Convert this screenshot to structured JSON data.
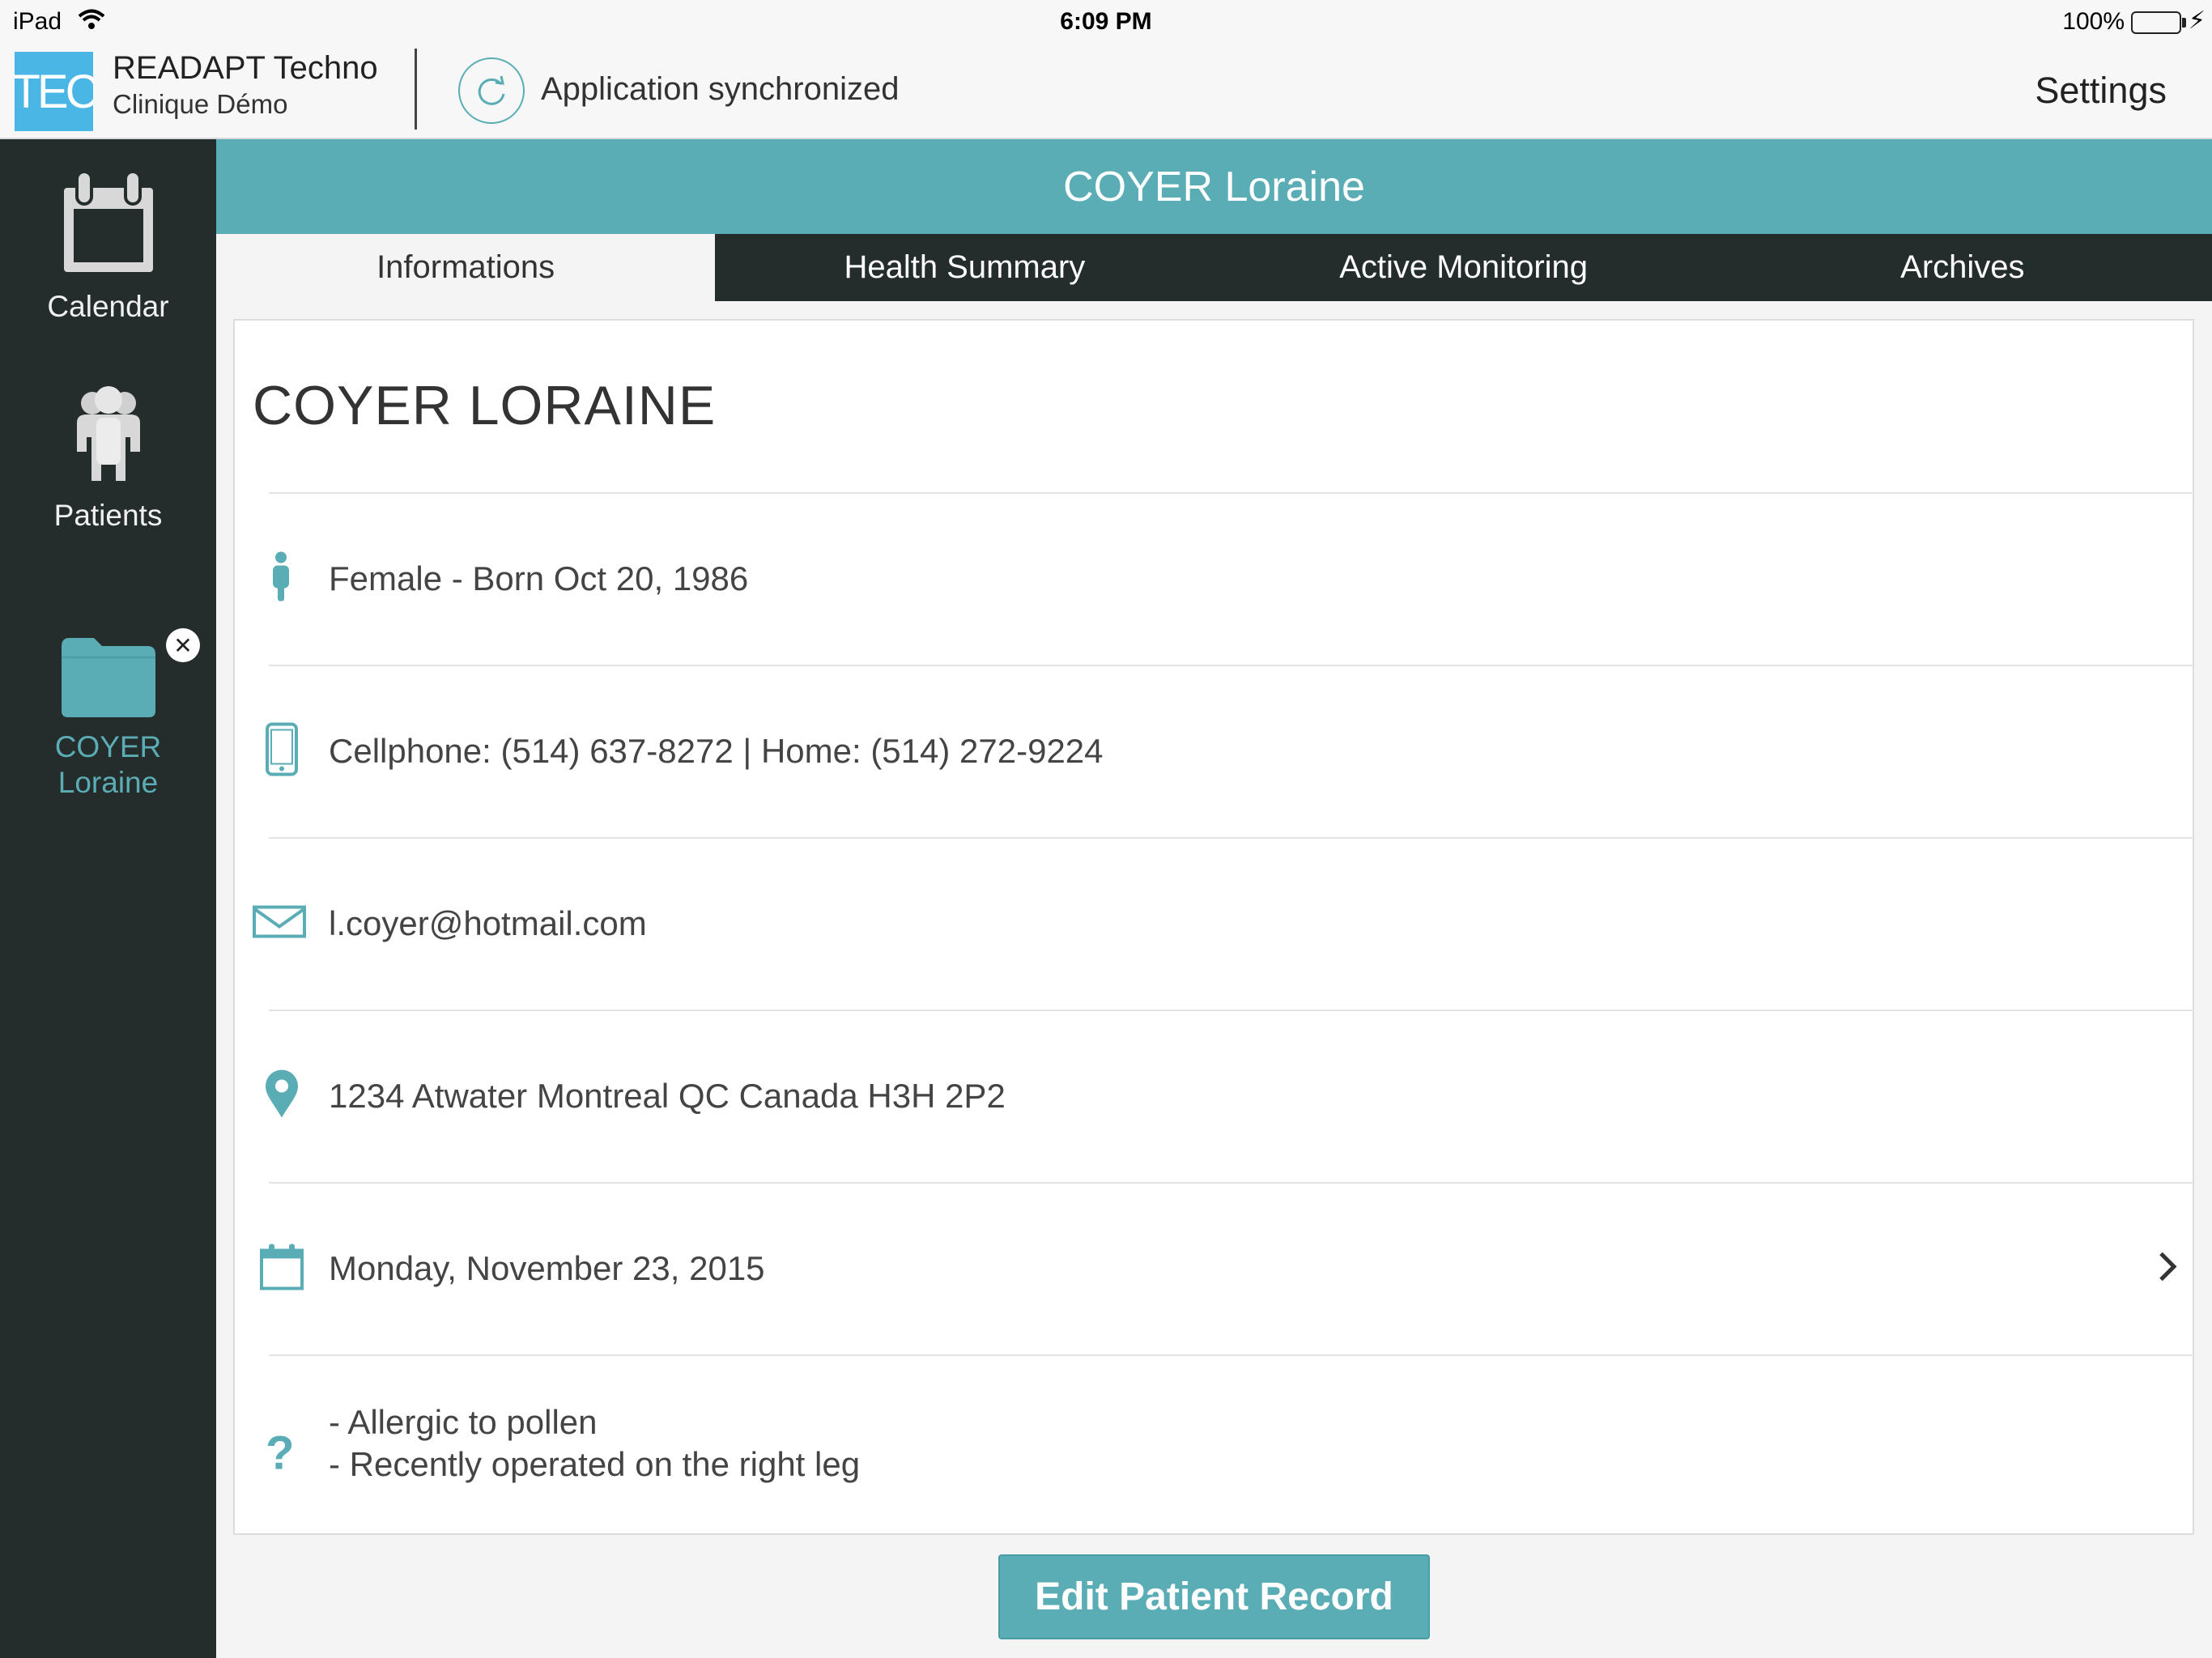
{
  "status_bar": {
    "device": "iPad",
    "time": "6:09 PM",
    "battery": "100%"
  },
  "header": {
    "logo_text": "TEC",
    "org_name": "READAPT Techno",
    "org_sub": "Clinique Démo",
    "sync_status": "Application synchronized",
    "settings_label": "Settings"
  },
  "sidebar": {
    "items": [
      {
        "label": "Calendar",
        "icon": "calendar-icon"
      },
      {
        "label": "Patients",
        "icon": "patients-icon"
      },
      {
        "label_line1": "COYER",
        "label_line2": "Loraine",
        "icon": "folder-icon"
      }
    ]
  },
  "patient": {
    "banner_title": "COYER Loraine",
    "heading": "COYER LORAINE",
    "gender_birth": "Female - Born Oct 20, 1986",
    "phones": "Cellphone: (514) 637-8272 | Home: (514) 272-9224",
    "email": "l.coyer@hotmail.com",
    "address": "1234 Atwater Montreal QC Canada H3H 2P2",
    "appointment": "Monday, November 23, 2015",
    "notes": [
      "- Allergic to pollen",
      "- Recently operated on the right leg"
    ]
  },
  "tabs": [
    {
      "label": "Informations",
      "active": true
    },
    {
      "label": "Health Summary",
      "active": false
    },
    {
      "label": "Active Monitoring",
      "active": false
    },
    {
      "label": "Archives",
      "active": false
    }
  ],
  "actions": {
    "edit_label": "Edit Patient Record"
  },
  "colors": {
    "accent": "#5aadb5",
    "sidebar_bg": "#252c2c",
    "logo_bg": "#4ab6e6"
  }
}
